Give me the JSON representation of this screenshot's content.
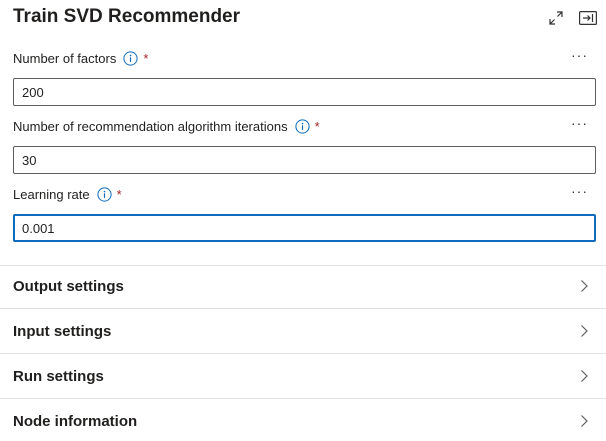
{
  "panel": {
    "title": "Train SVD Recommender",
    "expand_icon": "expand-diagonal-icon",
    "close_icon": "close-panel-icon"
  },
  "fields": [
    {
      "label": "Number of factors",
      "required_mark": "*",
      "value": "200",
      "more": "···",
      "focused": false
    },
    {
      "label": "Number of recommendation algorithm iterations",
      "required_mark": "*",
      "value": "30",
      "more": "···",
      "focused": false
    },
    {
      "label": "Learning rate",
      "required_mark": "*",
      "value": "0.001",
      "more": "···",
      "focused": true
    }
  ],
  "sections": [
    {
      "label": "Output settings"
    },
    {
      "label": "Input settings"
    },
    {
      "label": "Run settings"
    },
    {
      "label": "Node information"
    }
  ],
  "colors": {
    "accent": "#0f6cbd",
    "required": "#a4262c",
    "divider": "#e1dfdd"
  }
}
